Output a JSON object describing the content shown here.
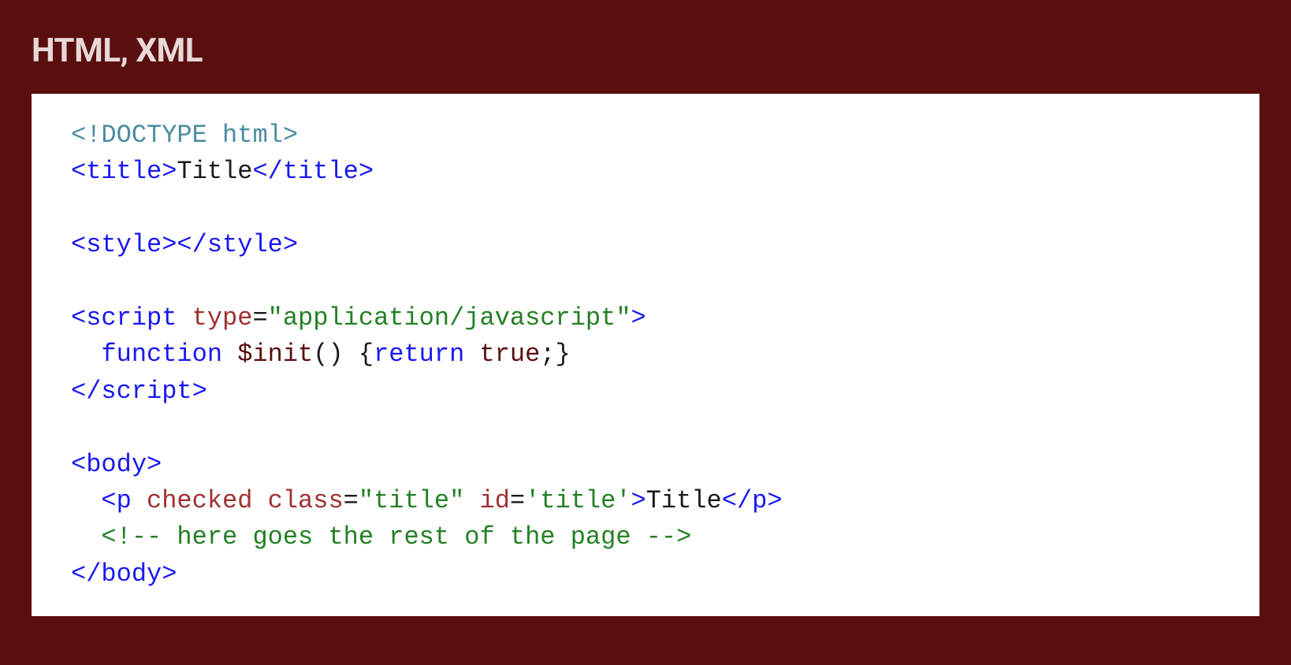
{
  "heading": "HTML, XML",
  "code": {
    "line1": {
      "doctype": "<!DOCTYPE html>"
    },
    "line2": {
      "open": "<title>",
      "text": "Title",
      "close": "</title>"
    },
    "line4": {
      "open": "<style>",
      "close": "</style>"
    },
    "line6": {
      "tagOpen": "<script",
      "attrName": "type",
      "eq": "=",
      "attrValue": "\"application/javascript\"",
      "tagClose": ">"
    },
    "line7": {
      "indent": "  ",
      "kwFunction": "function",
      "sp1": " ",
      "funcName": "$init",
      "parens": "()",
      "sp2": " ",
      "braceOpen": "{",
      "kwReturn": "return",
      "sp3": " ",
      "bool": "true",
      "semiBrace": ";}"
    },
    "line8": {
      "close": "</scr"
    },
    "line8b": {
      "close2": "ipt>"
    },
    "line10": {
      "open": "<body>"
    },
    "line11": {
      "indent": "  ",
      "tagOpen": "<p",
      "sp1": " ",
      "attr1": "checked",
      "sp2": " ",
      "attr2": "class",
      "eq2": "=",
      "val2": "\"title\"",
      "sp3": " ",
      "attr3": "id",
      "eq3": "=",
      "val3": "'title'",
      "tagClose": ">",
      "text": "Title",
      "close": "</p>"
    },
    "line12": {
      "indent": "  ",
      "comment": "<!-- here goes the rest of the page -->"
    },
    "line13": {
      "close": "</body>"
    }
  }
}
